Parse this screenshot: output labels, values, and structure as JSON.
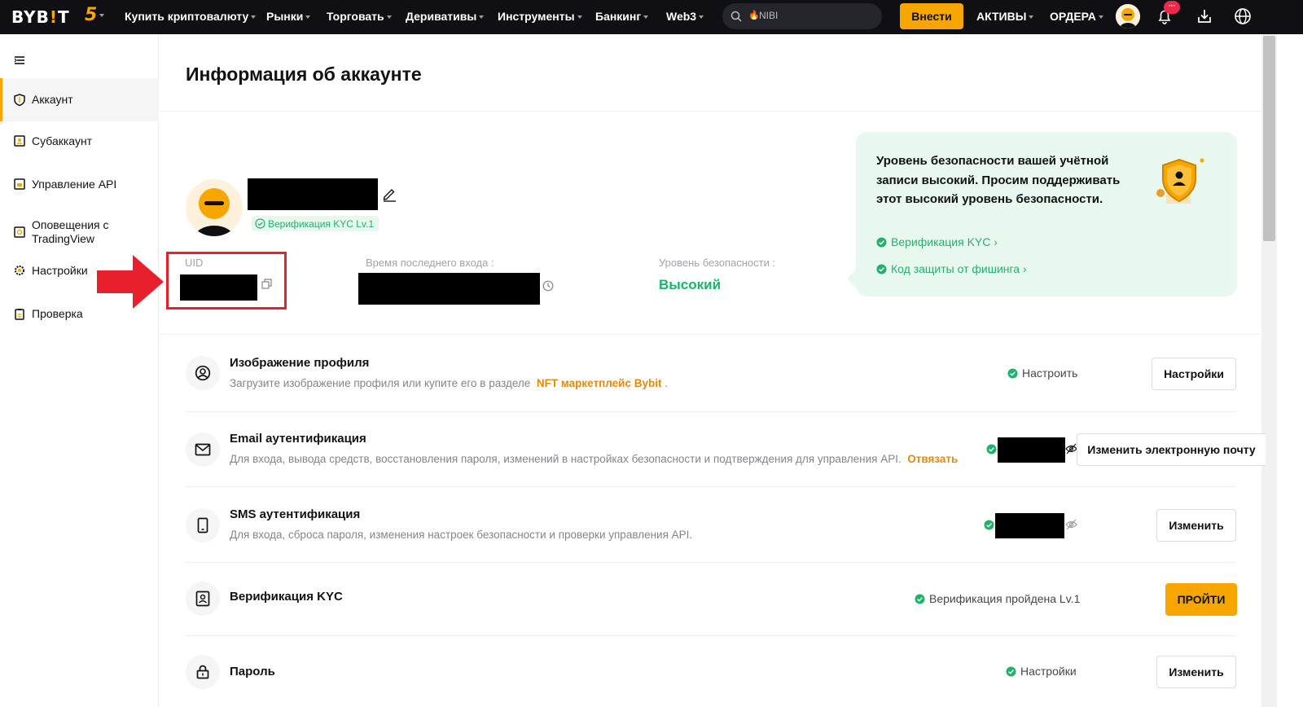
{
  "topnav": {
    "logo_left": "BYB",
    "logo_bang": "!",
    "logo_right": "T",
    "five_label": "5",
    "items": [
      {
        "label": "Купить криптовалюту"
      },
      {
        "label": "Рынки"
      },
      {
        "label": "Торговать"
      },
      {
        "label": "Деривативы"
      },
      {
        "label": "Инструменты"
      },
      {
        "label": "Банкинг"
      },
      {
        "label": "Web3"
      }
    ],
    "search_text": "NIBI",
    "deposit_label": "Внести",
    "assets_label": "АКТИВЫ",
    "orders_label": "ОРДЕРА",
    "notification_badge": "···"
  },
  "sidebar": {
    "items": [
      {
        "label": "Аккаунт",
        "icon": "shield-icon",
        "active": true
      },
      {
        "label": "Субаккаунт",
        "icon": "subaccount-icon"
      },
      {
        "label": "Управление API",
        "icon": "api-icon"
      },
      {
        "label": "Оповещения с TradingView",
        "icon": "alert-icon"
      },
      {
        "label": "Настройки",
        "icon": "gear-icon"
      },
      {
        "label": "Проверка",
        "icon": "clipboard-icon"
      }
    ]
  },
  "main": {
    "title": "Информация об аккаунте",
    "profile": {
      "kyc_badge": "Верификация KYC Lv.1"
    },
    "uid_label": "UID",
    "last_login_label": "Время последнего входа :",
    "security_level_label": "Уровень безопасности :",
    "security_level_value": "Высокий",
    "security_card": {
      "message": "Уровень безопасности вашей учётной записи высокий. Просим поддерживать этот высокий уровень безопасности.",
      "links": [
        {
          "label": "Верификация KYC ›"
        },
        {
          "label": "Код защиты от фишинга ›"
        }
      ]
    },
    "rows": [
      {
        "icon": "user-circle-icon",
        "title": "Изображение профиля",
        "desc": "Загрузите изображение профиля или купите его в разделе",
        "desc_link": "NFT маркетплейс Bybit",
        "desc_suffix": ".",
        "status": "Настроить",
        "button": "Настройки"
      },
      {
        "icon": "mail-icon",
        "title": "Email аутентификация",
        "desc": "Для входа, вывода средств, восстановления пароля, изменений в настройках безопасности и подтверждения для управления API.",
        "desc_link": "Отвязать",
        "button": "Изменить электронную почту"
      },
      {
        "icon": "phone-icon",
        "title": "SMS аутентификация",
        "desc": "Для входа, сброса пароля, изменения настроек безопасности и проверки управления API.",
        "button": "Изменить"
      },
      {
        "icon": "id-card-icon",
        "title": "Верификация KYC",
        "status": "Верификация пройдена Lv.1",
        "button": "ПРОЙТИ"
      },
      {
        "icon": "lock-icon",
        "title": "Пароль",
        "status": "Настройки",
        "button": "Изменить"
      }
    ]
  },
  "colors": {
    "brand": "#f7a600",
    "success": "#20b26c",
    "highlight_red": "#e8202c",
    "nav_bg": "#101014"
  }
}
